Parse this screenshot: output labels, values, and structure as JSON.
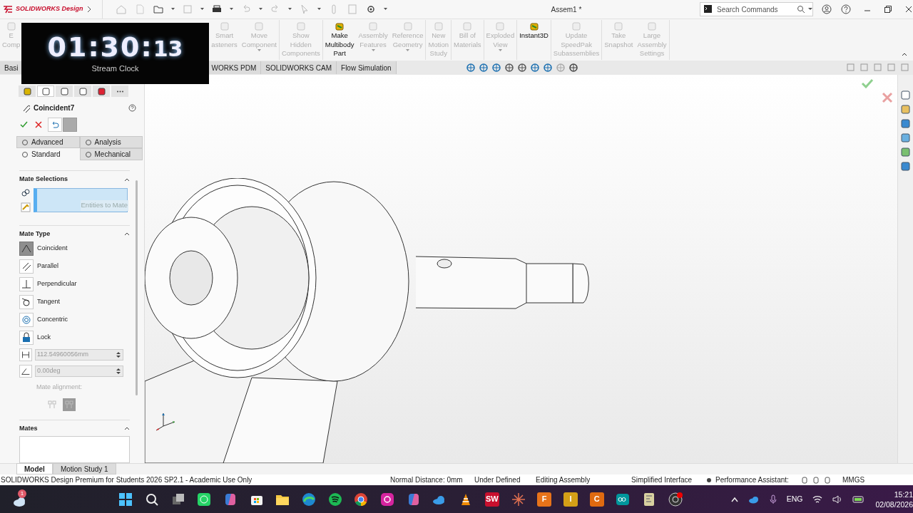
{
  "title_bar": {
    "logo": "SOLIDWORKS Design",
    "document_title": "Assem1 *",
    "search": {
      "placeholder": "Search Commands"
    }
  },
  "stream_clock": {
    "time": "01:30:",
    "seconds": "13",
    "caption": "Stream Clock"
  },
  "command_groups": [
    [
      {
        "lines": [
          "E",
          "Comp"
        ],
        "enabled": false,
        "dropdown": false
      }
    ],
    [
      {
        "lines": [
          "Smart",
          "asteners"
        ],
        "enabled": false,
        "dropdown": false
      },
      {
        "lines": [
          "Move",
          "Component"
        ],
        "enabled": false,
        "dropdown": true
      }
    ],
    [
      {
        "lines": [
          "Show",
          "Hidden",
          "Components"
        ],
        "enabled": false,
        "dropdown": false
      }
    ],
    [
      {
        "lines": [
          "Make",
          "Multibody",
          "Part"
        ],
        "enabled": true,
        "dropdown": false
      },
      {
        "lines": [
          "Assembly",
          "Features"
        ],
        "enabled": false,
        "dropdown": true
      },
      {
        "lines": [
          "Reference",
          "Geometry"
        ],
        "enabled": false,
        "dropdown": true
      }
    ],
    [
      {
        "lines": [
          "New",
          "Motion",
          "Study"
        ],
        "enabled": false,
        "dropdown": false
      }
    ],
    [
      {
        "lines": [
          "Bill of",
          "Materials"
        ],
        "enabled": false,
        "dropdown": false
      }
    ],
    [
      {
        "lines": [
          "Exploded",
          "View"
        ],
        "enabled": false,
        "dropdown": true
      }
    ],
    [
      {
        "lines": [
          "Instant3D"
        ],
        "enabled": true,
        "dropdown": false
      }
    ],
    [
      {
        "lines": [
          "Update",
          "SpeedPak",
          "Subassemblies"
        ],
        "enabled": false,
        "dropdown": false
      }
    ],
    [
      {
        "lines": [
          "Take",
          "Snapshot"
        ],
        "enabled": false,
        "dropdown": false
      },
      {
        "lines": [
          "Large",
          "Assembly",
          "Settings"
        ],
        "enabled": false,
        "dropdown": false
      }
    ]
  ],
  "ribbon_tabs": [
    {
      "label": "Basi"
    },
    {
      "label": "WORKS PDM"
    },
    {
      "label": "SOLIDWORKS CAM"
    },
    {
      "label": "Flow Simulation"
    }
  ],
  "panel_tabs": [
    {
      "selected": false
    },
    {
      "selected": true
    },
    {
      "selected": false
    },
    {
      "selected": false
    },
    {
      "selected": false
    },
    {
      "selected": false
    }
  ],
  "property_manager": {
    "title": "Coincident7",
    "tabs": [
      {
        "label": "Advanced",
        "selected": false
      },
      {
        "label": "Analysis",
        "selected": false
      },
      {
        "label": "Standard",
        "selected": true
      },
      {
        "label": "Mechanical",
        "selected": false
      }
    ],
    "mate_selections": {
      "title": "Mate Selections",
      "hint": "Entities to Mate"
    },
    "mate_type": {
      "title": "Mate Type",
      "options": [
        {
          "label": "Coincident",
          "selected": true
        },
        {
          "label": "Parallel",
          "selected": false
        },
        {
          "label": "Perpendicular",
          "selected": false
        },
        {
          "label": "Tangent",
          "selected": false
        },
        {
          "label": "Concentric",
          "selected": false
        },
        {
          "label": "Lock",
          "selected": false
        }
      ],
      "distance": {
        "value": "112.54960056mm",
        "disabled": true
      },
      "angle": {
        "value": "0.00deg",
        "disabled": true
      },
      "alignment_label": "Mate alignment:",
      "alignment_options": [
        {
          "selected": false
        },
        {
          "selected": true
        }
      ]
    },
    "mates": {
      "title": "Mates"
    }
  },
  "bottom_tabs": [
    {
      "label": "Model",
      "selected": true
    },
    {
      "label": "Motion Study 1",
      "selected": false
    }
  ],
  "status_bar": {
    "product": "SOLIDWORKS Design Premium for Students 2026 SP2.1 - Academic Use Only",
    "items": [
      "Normal Distance: 0mm",
      "Under Defined",
      "Editing Assembly",
      "Simplified Interface"
    ],
    "performance": "Performance Assistant:",
    "units": "MMGS"
  },
  "taskbar": {
    "notification_count": "1",
    "apps": [
      {
        "kind": "start"
      },
      {
        "kind": "search"
      },
      {
        "kind": "taskview"
      },
      {
        "kind": "chat"
      },
      {
        "kind": "copilot"
      },
      {
        "kind": "store"
      },
      {
        "kind": "folder"
      },
      {
        "kind": "edge"
      },
      {
        "kind": "music"
      },
      {
        "kind": "chrome"
      },
      {
        "kind": "camera"
      },
      {
        "kind": "copilot"
      },
      {
        "kind": "cloud"
      },
      {
        "kind": "cone"
      },
      {
        "kind": "letter",
        "label": "SW",
        "color": "#c8102e"
      },
      {
        "kind": "star"
      },
      {
        "kind": "letter",
        "label": "F",
        "color": "#e8731a"
      },
      {
        "kind": "letter",
        "label": "I",
        "color": "#d4a017"
      },
      {
        "kind": "letter",
        "label": "C",
        "color": "#e06a10"
      },
      {
        "kind": "infinity"
      },
      {
        "kind": "board"
      },
      {
        "kind": "record"
      }
    ],
    "language": "ENG",
    "time": "15:21",
    "date": "02/08/2026"
  }
}
